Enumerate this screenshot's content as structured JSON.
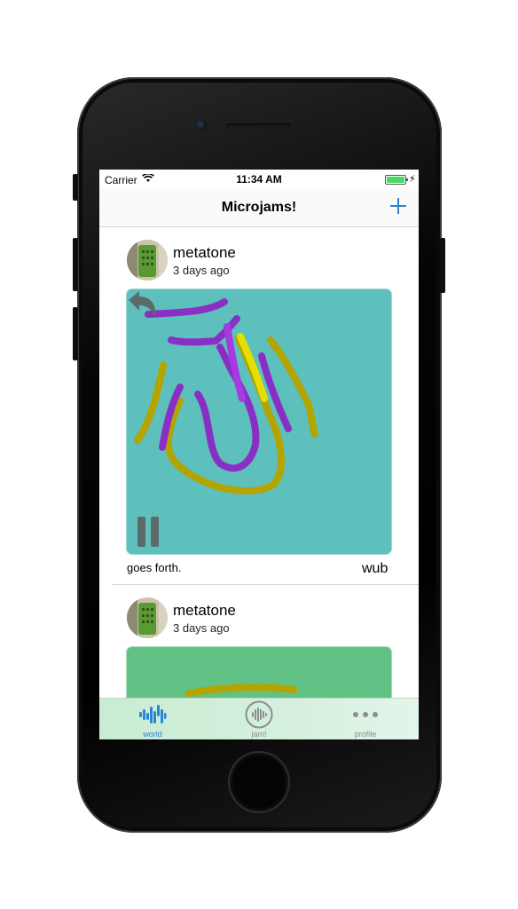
{
  "status_bar": {
    "carrier": "Carrier",
    "time": "11:34 AM"
  },
  "nav": {
    "title": "Microjams!",
    "add_icon": "plus-icon"
  },
  "feed": {
    "items": [
      {
        "username": "metatone",
        "time_ago": "3 days ago",
        "caption": "goes forth.",
        "instrument": "wub",
        "canvas_color": "#5dc0bd"
      },
      {
        "username": "metatone",
        "time_ago": "3 days ago",
        "canvas_color": "#62c285"
      }
    ]
  },
  "tab_bar": {
    "tabs": [
      {
        "label": "world",
        "icon": "world-waveform-icon",
        "selected": true
      },
      {
        "label": "jam!",
        "icon": "jam-waveform-icon",
        "selected": false
      },
      {
        "label": "profile",
        "icon": "more-dots-icon",
        "selected": false
      }
    ]
  },
  "colors": {
    "accent": "#2a83d8",
    "purple_stroke": "#8a2fc4",
    "olive_stroke": "#b4a400",
    "yellow_stroke": "#e6de00",
    "violet_stroke": "#a63ae0"
  }
}
